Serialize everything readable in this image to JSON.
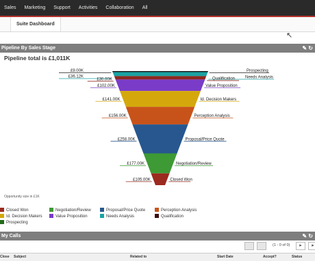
{
  "nav": {
    "items": [
      "Sales",
      "Marketing",
      "Support",
      "Activities",
      "Collaboration",
      "All"
    ]
  },
  "tabs": {
    "suite_dashboard": "Suite Dashboard"
  },
  "pipeline_dashlet": {
    "title": "Pipeline By Sales Stage",
    "total_text": "Pipeline total is £1,011K",
    "footnote": "Opportunity size in £1K",
    "icons": [
      "edit-icon",
      "refresh-icon"
    ]
  },
  "chart_data": {
    "type": "funnel",
    "stages": [
      {
        "name": "Prospecting",
        "value": 9,
        "label": "£9.00K",
        "color": "#1a1a1a"
      },
      {
        "name": "Needs Analysis",
        "value": 36.12,
        "label": "£36.12K",
        "color": "#1aa3a3"
      },
      {
        "name": "Qualification",
        "value": 30,
        "label": "£30.00K",
        "color": "#8b2a1f"
      },
      {
        "name": "Value Proposition",
        "value": 102,
        "label": "£102.00K",
        "color": "#7a3cc8"
      },
      {
        "name": "Id. Decision Makers",
        "value": 141,
        "label": "£141.00K",
        "color": "#d4a80c"
      },
      {
        "name": "Perception Analysis",
        "value": 156,
        "label": "£156.00K",
        "color": "#c8531a"
      },
      {
        "name": "Proposal/Price Quote",
        "value": 258,
        "label": "£258.00K",
        "color": "#27578e"
      },
      {
        "name": "Negotiation/Review",
        "value": 177,
        "label": "£177.00K",
        "color": "#3d9a34"
      },
      {
        "name": "Closed Won",
        "value": 105,
        "label": "£105.00K",
        "color": "#9b2a1f"
      }
    ],
    "legend": [
      {
        "name": "Closed Won",
        "color": "#9b2a1f"
      },
      {
        "name": "Negotiation/Review",
        "color": "#3d9a34"
      },
      {
        "name": "Proposal/Price Quote",
        "color": "#27578e"
      },
      {
        "name": "Perception Analysis",
        "color": "#c8531a"
      },
      {
        "name": "Id. Decision Makers",
        "color": "#d4a80c"
      },
      {
        "name": "Value Proposition",
        "color": "#7a3cc8"
      },
      {
        "name": "Needs Analysis",
        "color": "#1aa3a3"
      },
      {
        "name": "Qualification",
        "color": "#3a0f0f"
      },
      {
        "name": "Prospecting",
        "color": "#236b1a"
      }
    ]
  },
  "calls_dashlet": {
    "title": "My Calls",
    "pager_text": "(1 - 0 of 0)",
    "columns": [
      "Close",
      "Subject",
      "Related to",
      "Start Date",
      "Accept?",
      "Status"
    ]
  }
}
